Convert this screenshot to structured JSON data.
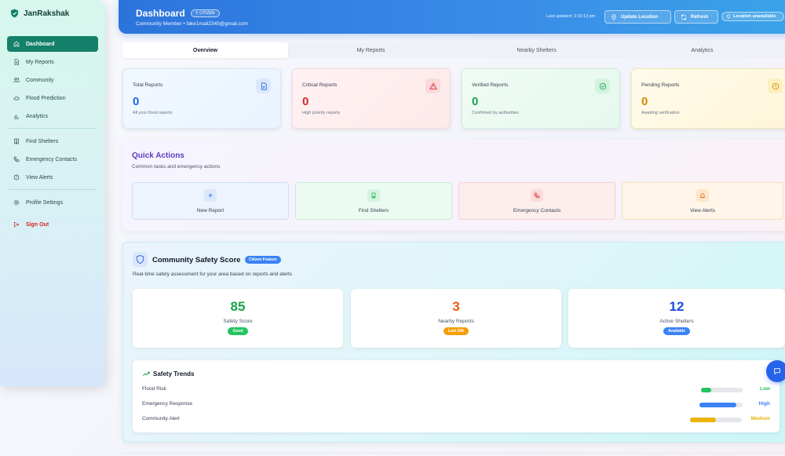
{
  "brand": {
    "name": "JanRakshak",
    "accent": "#14806a"
  },
  "sidebar": {
    "items": [
      {
        "label": "Dashboard",
        "icon": "home-icon",
        "active": true
      },
      {
        "label": "My Reports",
        "icon": "file-icon"
      },
      {
        "label": "Community",
        "icon": "users-icon"
      },
      {
        "label": "Flood Prediction",
        "icon": "cloud-icon"
      },
      {
        "label": "Analytics",
        "icon": "bar-chart-icon"
      },
      {
        "label": "Find Shelters",
        "icon": "building-icon"
      },
      {
        "label": "Emergency Contacts",
        "icon": "phone-icon"
      },
      {
        "label": "View Alerts",
        "icon": "alert-icon"
      },
      {
        "label": "Profile Settings",
        "icon": "gear-icon"
      },
      {
        "label": "Sign Out",
        "icon": "logout-icon"
      }
    ]
  },
  "header": {
    "title": "Dashboard",
    "role_badge": "CITIZEN",
    "subtitle": "Community Member • fake1mail2345@gmail.com",
    "last_updated": "Last updated: 3:10:13 pm",
    "update_location_label": "Update Location",
    "refresh_label": "Refresh",
    "location_status": "Location unavailable"
  },
  "tabs": [
    {
      "label": "Overview",
      "active": true
    },
    {
      "label": "My Reports"
    },
    {
      "label": "Nearby Shelters"
    },
    {
      "label": "Analytics"
    }
  ],
  "stats": {
    "total": {
      "label": "Total Reports",
      "value": "0",
      "desc": "All your flood reports"
    },
    "critical": {
      "label": "Critical Reports",
      "value": "0",
      "desc": "High priority reports"
    },
    "verified": {
      "label": "Verified Reports",
      "value": "0",
      "desc": "Confirmed by authorities"
    },
    "pending": {
      "label": "Pending Reports",
      "value": "0",
      "desc": "Awaiting verification"
    }
  },
  "quick_actions": {
    "title": "Quick Actions",
    "subtitle": "Common tasks and emergency actions",
    "new_report": "New Report",
    "find_shelters": "Find Shelters",
    "emergency_contacts": "Emergency Contacts",
    "view_alerts": "View Alerts"
  },
  "community_safety": {
    "title": "Community Safety Score",
    "badge": "Citizen Feature",
    "subtitle": "Real-time safety assessment for your area based on reports and alerts",
    "metrics": {
      "score": {
        "value": "85",
        "label": "Safety Score",
        "badge": "Good"
      },
      "reports": {
        "value": "3",
        "label": "Nearby Reports",
        "badge": "Last 24h"
      },
      "shelters": {
        "value": "12",
        "label": "Active Shelters",
        "badge": "Available"
      }
    },
    "trends": {
      "title": "Safety Trends",
      "rows": [
        {
          "label": "Flood Risk",
          "value": "Low",
          "level": 0.25,
          "color": "#22c55e"
        },
        {
          "label": "Emergency Response",
          "value": "High",
          "level": 0.85,
          "color": "#3b82f6"
        },
        {
          "label": "Community Alert",
          "value": "Medium",
          "level": 0.5,
          "color": "#eab308"
        }
      ]
    }
  }
}
